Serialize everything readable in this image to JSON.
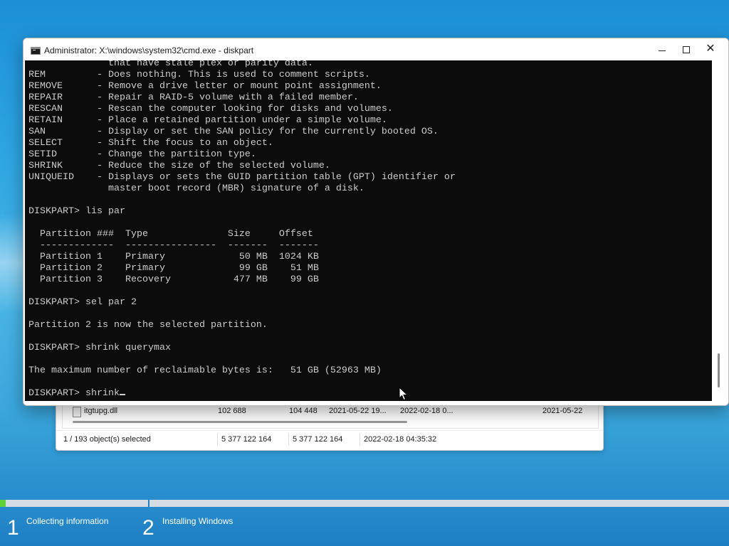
{
  "explorer": {
    "file_row": {
      "name": "itgtupg.dll",
      "size": "102 688",
      "size2": "104 448",
      "created": "2021-05-22 19...",
      "modified": "2022-02-18 0...",
      "accessed": "2021-05-22"
    },
    "status": {
      "selected": "1 / 193 object(s) selected",
      "size": "5 377 122 164",
      "packed": "5 377 122 164",
      "modified": "2022-02-18 04:35:32"
    }
  },
  "cmd": {
    "title": "Administrator: X:\\windows\\system32\\cmd.exe - diskpart",
    "console_lines": [
      "              that have stale plex or parity data.",
      "REM         - Does nothing. This is used to comment scripts.",
      "REMOVE      - Remove a drive letter or mount point assignment.",
      "REPAIR      - Repair a RAID-5 volume with a failed member.",
      "RESCAN      - Rescan the computer looking for disks and volumes.",
      "RETAIN      - Place a retained partition under a simple volume.",
      "SAN         - Display or set the SAN policy for the currently booted OS.",
      "SELECT      - Shift the focus to an object.",
      "SETID       - Change the partition type.",
      "SHRINK      - Reduce the size of the selected volume.",
      "UNIQUEID    - Displays or sets the GUID partition table (GPT) identifier or",
      "              master boot record (MBR) signature of a disk.",
      "",
      "DISKPART> lis par",
      "",
      "  Partition ###  Type              Size     Offset",
      "  -------------  ----------------  -------  -------",
      "  Partition 1    Primary             50 MB  1024 KB",
      "  Partition 2    Primary             99 GB    51 MB",
      "  Partition 3    Recovery           477 MB    99 GB",
      "",
      "DISKPART> sel par 2",
      "",
      "Partition 2 is now the selected partition.",
      "",
      "DISKPART> shrink querymax",
      "",
      "The maximum number of reclaimable bytes is:   51 GB (52963 MB)",
      ""
    ],
    "prompt_line": "DISKPART> shrink"
  },
  "setup": {
    "progress_fraction": 0.008,
    "steps": [
      {
        "number": "1",
        "label": "Collecting information"
      },
      {
        "number": "2",
        "label": "Installing Windows"
      }
    ]
  }
}
